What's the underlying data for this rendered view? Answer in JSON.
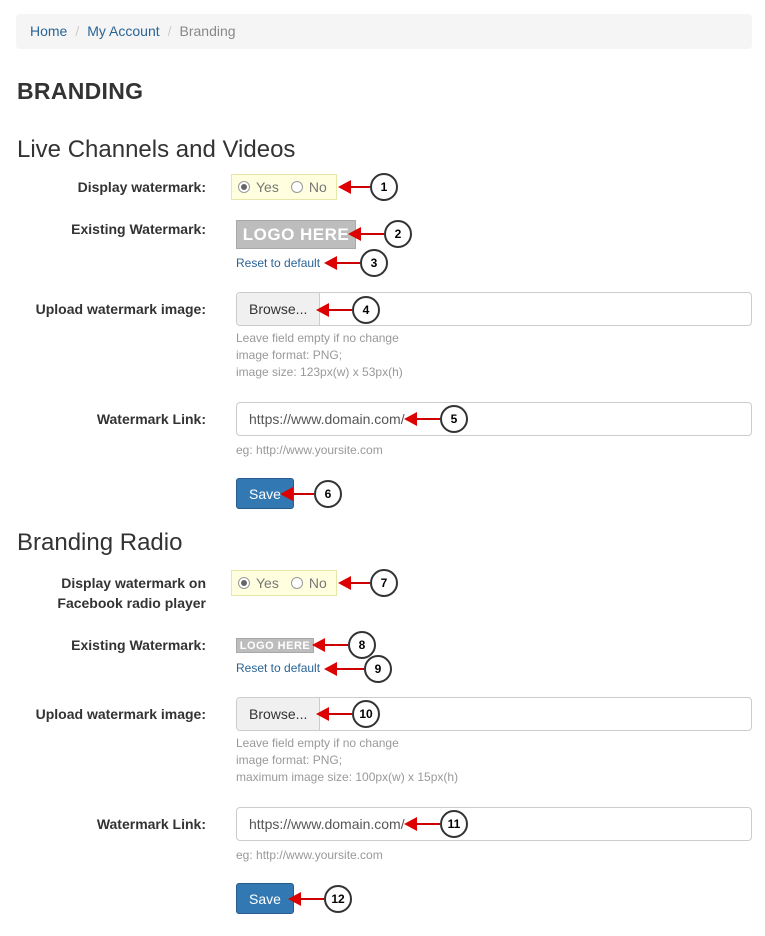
{
  "breadcrumb": {
    "home": "Home",
    "account": "My Account",
    "current": "Branding",
    "sep": "/"
  },
  "page_title": "BRANDING",
  "section1": {
    "title": "Live Channels and Videos",
    "display_label": "Display watermark:",
    "yes": "Yes",
    "no": "No",
    "existing_label": "Existing Watermark:",
    "logo_text": "LOGO HERE",
    "reset": "Reset to default",
    "upload_label": "Upload watermark image:",
    "browse": "Browse...",
    "help1": "Leave field empty if no change",
    "help2": "image format: PNG;",
    "help3": "image size: 123px(w) x 53px(h)",
    "link_label": "Watermark Link:",
    "link_value": "https://www.domain.com/",
    "link_help": "eg: http://www.yoursite.com",
    "save": "Save"
  },
  "section2": {
    "title": "Branding Radio",
    "display_label1": "Display watermark on",
    "display_label2": "Facebook radio player",
    "yes": "Yes",
    "no": "No",
    "existing_label": "Existing Watermark:",
    "logo_text": "LOGO HERE",
    "reset": "Reset to default",
    "upload_label": "Upload watermark image:",
    "browse": "Browse...",
    "help1": "Leave field empty if no change",
    "help2": "image format: PNG;",
    "help3": "maximum image size: 100px(w) x 15px(h)",
    "link_label": "Watermark Link:",
    "link_value": "https://www.domain.com/",
    "link_help": "eg: http://www.yoursite.com",
    "save": "Save"
  },
  "callouts": [
    "1",
    "2",
    "3",
    "4",
    "5",
    "6",
    "7",
    "8",
    "9",
    "10",
    "11",
    "12"
  ],
  "colors": {
    "link": "#2a6496",
    "primary": "#3278b3",
    "arrow": "#dd0000",
    "highlight": "#ffffe0"
  }
}
